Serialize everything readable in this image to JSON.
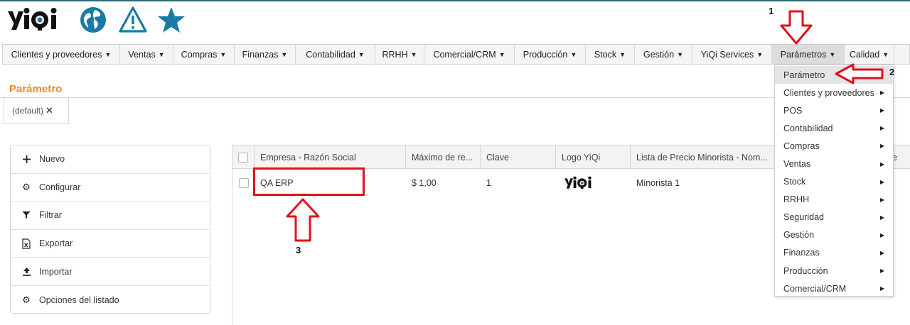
{
  "header": {
    "brand_colors": {
      "accent": "#1a7aa6",
      "logo_dark": "#111111",
      "logo_accent": "#1a7aa6"
    },
    "icons": [
      "globe-icon",
      "warning-icon",
      "star-icon"
    ]
  },
  "menubar": {
    "items": [
      {
        "label": "Clientes y proveedores",
        "width": 165
      },
      {
        "label": "Ventas",
        "width": 75
      },
      {
        "label": "Compras",
        "width": 86
      },
      {
        "label": "Finanzas",
        "width": 86
      },
      {
        "label": "Contabilidad",
        "width": 112
      },
      {
        "label": "RRHH",
        "width": 69
      },
      {
        "label": "Comercial/CRM",
        "width": 127
      },
      {
        "label": "Producción",
        "width": 100
      },
      {
        "label": "Stock",
        "width": 69
      },
      {
        "label": "Gestión",
        "width": 81
      },
      {
        "label": "YiQi Services",
        "width": 112
      },
      {
        "label": "Parámetros",
        "width": 102
      },
      {
        "label": "Calidad",
        "width": 70
      }
    ],
    "active_index": 11
  },
  "page": {
    "title": "Parámetro",
    "tab_label": "(default)"
  },
  "actions": [
    {
      "label": "Nuevo",
      "icon": "plus-icon"
    },
    {
      "label": "Configurar",
      "icon": "gear-icon"
    },
    {
      "label": "Filtrar",
      "icon": "filter-icon"
    },
    {
      "label": "Exportar",
      "icon": "excel-file-icon"
    },
    {
      "label": "Importar",
      "icon": "upload-icon"
    },
    {
      "label": "Opciones del listado",
      "icon": "gear-icon"
    }
  ],
  "grid": {
    "columns": [
      "Empresa - Razón Social",
      "Máximo de re...",
      "Clave",
      "Logo YiQi",
      "Lista de Precio Minorista - Nom..."
    ],
    "rows": [
      {
        "empresa": "QA ERP",
        "maximo": "$ 1,00",
        "clave": "1",
        "logo": "yiqi-logo",
        "lista": "Minorista 1"
      }
    ],
    "partial_header_tail": "e"
  },
  "dropdown": {
    "items": [
      {
        "label": "Parámetro",
        "submenu": false
      },
      {
        "label": "Clientes y proveedores",
        "submenu": true
      },
      {
        "label": "POS",
        "submenu": true
      },
      {
        "label": "Contabilidad",
        "submenu": true
      },
      {
        "label": "Compras",
        "submenu": true
      },
      {
        "label": "Ventas",
        "submenu": true
      },
      {
        "label": "Stock",
        "submenu": true
      },
      {
        "label": "RRHH",
        "submenu": true
      },
      {
        "label": "Seguridad",
        "submenu": true
      },
      {
        "label": "Gestión",
        "submenu": true
      },
      {
        "label": "Finanzas",
        "submenu": true
      },
      {
        "label": "Producción",
        "submenu": true
      },
      {
        "label": "Comercial/CRM",
        "submenu": true
      }
    ],
    "active_index": 0
  },
  "annotations": {
    "step1": "1",
    "step2": "2",
    "step3": "3",
    "color": "#e0101d"
  }
}
